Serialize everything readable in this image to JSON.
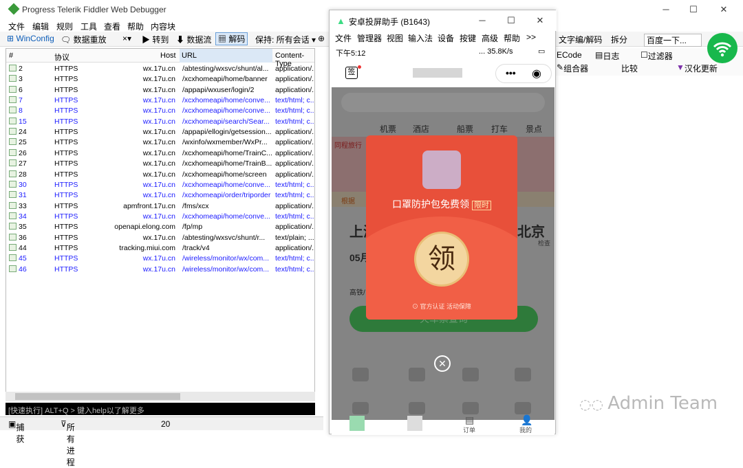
{
  "fiddler": {
    "title": "Progress Telerik Fiddler Web Debugger",
    "menu": [
      "文件",
      "编辑",
      "规则",
      "工具",
      "查看",
      "帮助",
      "内容块"
    ],
    "toolbar": [
      "WinConfig",
      "数据重放",
      "×▾",
      "▶ 转到",
      "数据流",
      "解码",
      "保持: 所有会话 ▾"
    ],
    "toolbar_right": [
      "文字编/解码",
      "拆分",
      "百度一下..."
    ],
    "columns": {
      "num": "#",
      "proto": "协议",
      "host": "Host",
      "url": "URL",
      "ctype": "Content-Type"
    },
    "rows": [
      {
        "id": "2",
        "proto": "HTTPS",
        "host": "wx.17u.cn",
        "url": "/abtesting/wxsvc/shunt/al...",
        "ctype": "application/...",
        "blue": false
      },
      {
        "id": "3",
        "proto": "HTTPS",
        "host": "wx.17u.cn",
        "url": "/xcxhomeapi/home/banner",
        "ctype": "application/...",
        "blue": false
      },
      {
        "id": "6",
        "proto": "HTTPS",
        "host": "wx.17u.cn",
        "url": "/appapi/wxuser/login/2",
        "ctype": "application/...",
        "blue": false
      },
      {
        "id": "7",
        "proto": "HTTPS",
        "host": "wx.17u.cn",
        "url": "/xcxhomeapi/home/conve...",
        "ctype": "text/html; c...",
        "blue": true
      },
      {
        "id": "8",
        "proto": "HTTPS",
        "host": "wx.17u.cn",
        "url": "/xcxhomeapi/home/conve...",
        "ctype": "text/html; c...",
        "blue": true
      },
      {
        "id": "15",
        "proto": "HTTPS",
        "host": "wx.17u.cn",
        "url": "/xcxhomeapi/search/Sear...",
        "ctype": "text/html; c...",
        "blue": true
      },
      {
        "id": "24",
        "proto": "HTTPS",
        "host": "wx.17u.cn",
        "url": "/appapi/ellogin/getsession...",
        "ctype": "application/...",
        "blue": false
      },
      {
        "id": "25",
        "proto": "HTTPS",
        "host": "wx.17u.cn",
        "url": "/wxinfo/wxmember/WxPr...",
        "ctype": "application/...",
        "blue": false
      },
      {
        "id": "26",
        "proto": "HTTPS",
        "host": "wx.17u.cn",
        "url": "/xcxhomeapi/home/TrainC...",
        "ctype": "application/...",
        "blue": false
      },
      {
        "id": "27",
        "proto": "HTTPS",
        "host": "wx.17u.cn",
        "url": "/xcxhomeapi/home/TrainB...",
        "ctype": "application/...",
        "blue": false
      },
      {
        "id": "28",
        "proto": "HTTPS",
        "host": "wx.17u.cn",
        "url": "/xcxhomeapi/home/screen",
        "ctype": "application/...",
        "blue": false
      },
      {
        "id": "30",
        "proto": "HTTPS",
        "host": "wx.17u.cn",
        "url": "/xcxhomeapi/home/conve...",
        "ctype": "text/html; c...",
        "blue": true
      },
      {
        "id": "31",
        "proto": "HTTPS",
        "host": "wx.17u.cn",
        "url": "/xcxhomeapi/order/triporder",
        "ctype": "text/html; c...",
        "blue": true
      },
      {
        "id": "33",
        "proto": "HTTPS",
        "host": "apmfront.17u.cn",
        "url": "/fms/xcx",
        "ctype": "application/...",
        "blue": false
      },
      {
        "id": "34",
        "proto": "HTTPS",
        "host": "wx.17u.cn",
        "url": "/xcxhomeapi/home/conve...",
        "ctype": "text/html; c...",
        "blue": true
      },
      {
        "id": "35",
        "proto": "HTTPS",
        "host": "openapi.elong.com",
        "url": "/fp/mp",
        "ctype": "application/...",
        "blue": false
      },
      {
        "id": "36",
        "proto": "HTTPS",
        "host": "wx.17u.cn",
        "url": "/abtesting/wxsvc/shunt/r...",
        "ctype": "text/plain; ...",
        "blue": false
      },
      {
        "id": "44",
        "proto": "HTTPS",
        "host": "tracking.miui.com",
        "url": "/track/v4",
        "ctype": "application/...",
        "blue": false
      },
      {
        "id": "45",
        "proto": "HTTPS",
        "host": "wx.17u.cn",
        "url": "/wireless/monitor/wx/com...",
        "ctype": "text/html; c...",
        "blue": true
      },
      {
        "id": "46",
        "proto": "HTTPS",
        "host": "wx.17u.cn",
        "url": "/wireless/monitor/wx/com...",
        "ctype": "text/html; c...",
        "blue": true
      }
    ],
    "quickexec": "[快速执行] ALT+Q > 键入help以了解更多",
    "status": {
      "capture": "捕获",
      "process": "所有进程",
      "count": "20"
    },
    "right_tabs": [
      "ECode",
      "日志",
      "过滤器"
    ],
    "right_tabs2": [
      "组合器",
      "比较",
      "汉化更新"
    ]
  },
  "phone": {
    "title": "安卓投屏助手 (B1643)",
    "menu": [
      "文件",
      "管理器",
      "视图",
      "输入法",
      "设备",
      "按键",
      "高级",
      "帮助",
      ">>"
    ],
    "time": "下午5:12",
    "net": "... 35.8K/s",
    "nav_sign": "签",
    "tabs": [
      "机票",
      "酒店",
      "船票",
      "打车",
      "景点"
    ],
    "redpack": {
      "text": "口罩防护包免费领",
      "badge": "限时",
      "coin": "领",
      "guarantee": "官方认证 活动保障"
    },
    "bottom": [
      "订单",
      "我的"
    ],
    "bg_texts": {
      "city1": "上海",
      "city2": "北京",
      "date": "05月",
      "rail": "高铁/",
      "search": "火车票查询",
      "check": "检查",
      "notice": "根据",
      "tag": "同程旅行"
    }
  },
  "watermark": "Admin Team"
}
